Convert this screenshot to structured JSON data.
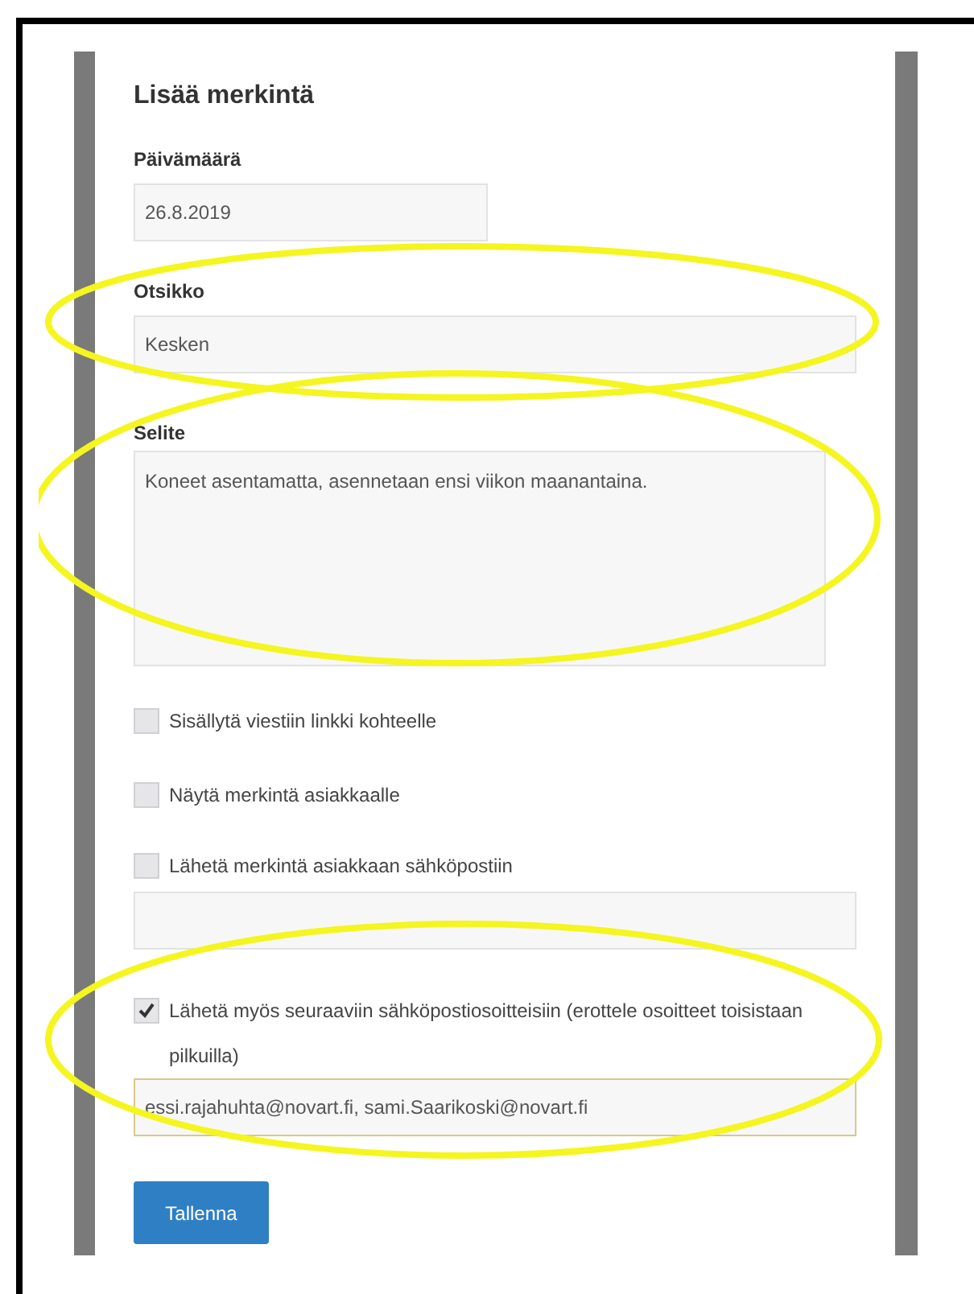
{
  "form": {
    "title": "Lisää merkintä",
    "items": [
      {
        "kind": "short_input",
        "label": "Päivämäärä",
        "value": "26.8.2019"
      },
      {
        "kind": "input",
        "label": "Otsikko",
        "value": "Kesken"
      },
      {
        "kind": "textarea",
        "label": "Selite",
        "value": "Koneet asentamatta, asennetaan ensi viikon maanantaina."
      },
      {
        "kind": "checkbox",
        "label": "Sisällytä viestiin linkki kohteelle",
        "checked": false
      },
      {
        "kind": "checkbox",
        "label": "Näytä merkintä asiakkaalle",
        "checked": false
      },
      {
        "kind": "checkbox",
        "label": "Lähetä merkintä asiakkaan sähköpostiin",
        "checked": false
      },
      {
        "kind": "input"
      },
      {
        "kind": "checkbox",
        "label": "Lähetä myös seuraaviin sähköpostiosoitteisiin (erottele osoitteet toisistaan pilkuilla)",
        "checked": true
      },
      {
        "kind": "input",
        "value": "essi.rajahuhta@novart.fi, sami.Saarikoski@novart.fi",
        "focused": true
      }
    ],
    "save_button": "Tallenna"
  }
}
